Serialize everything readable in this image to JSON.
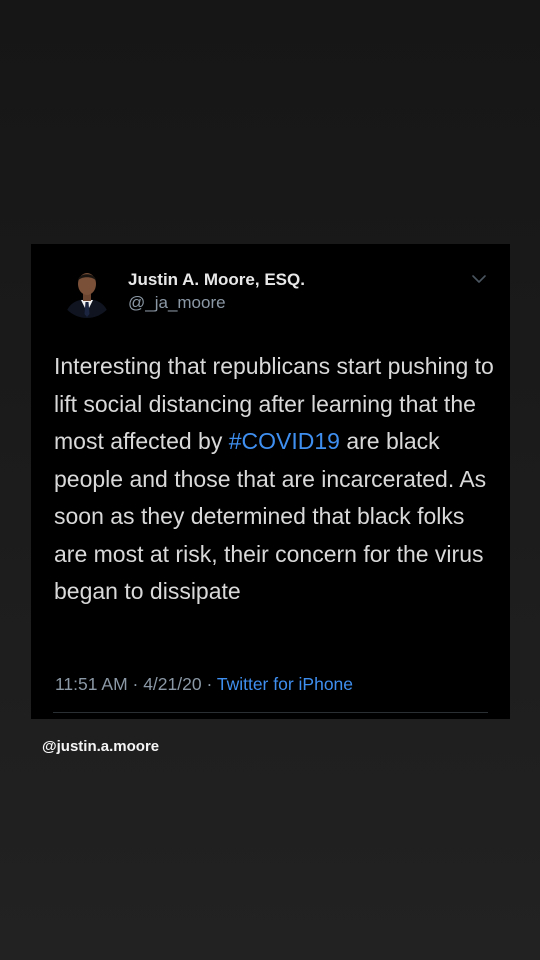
{
  "tweet": {
    "author_name": "Justin A. Moore, ESQ.",
    "author_handle": "@_ja_moore",
    "text_before": "Interesting that republicans start pushing to lift social distancing after learning that the most affected by ",
    "hashtag": "#COVID19",
    "text_after": " are black people and those that are incarcerated. As soon as they determined that black folks are most at risk, their concern for the virus began to dissipate",
    "time": "11:51 AM",
    "date": "4/21/20",
    "separator": " · ",
    "source": "Twitter for iPhone",
    "menu_icon": "chevron-down-icon"
  },
  "caption": "@justin.a.moore",
  "colors": {
    "card_background": "#000000",
    "page_background": "#1b1b1b",
    "link": "#3f8ff0",
    "secondary_text": "#8b98a5",
    "primary_text": "#d9d9d9"
  }
}
